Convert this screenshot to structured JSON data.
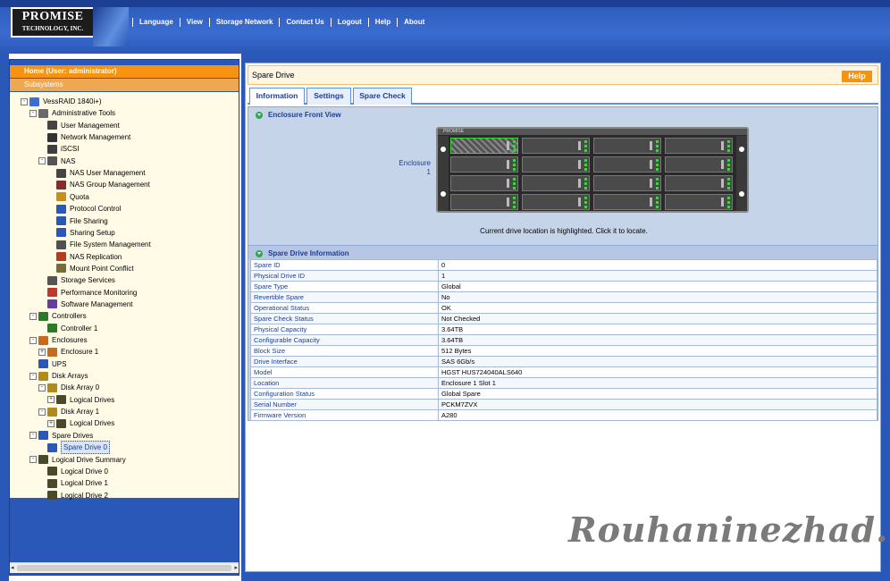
{
  "brand": {
    "line1": "PROMISE",
    "line2": "TECHNOLOGY, INC."
  },
  "nav": [
    "Language",
    "View",
    "Storage Network",
    "Contact Us",
    "Logout",
    "Help",
    "About"
  ],
  "sidebar": {
    "home": "Home (User: administrator)",
    "subsystems": "Subsystems",
    "tree": [
      {
        "label": "VessRAID 1840i+)",
        "level": 1,
        "exp": "-",
        "icon": "subsystem-icon"
      },
      {
        "label": "Administrative Tools",
        "level": 2,
        "exp": "-",
        "icon": "tools-icon"
      },
      {
        "label": "User Management",
        "level": 3,
        "icon": "user-icon"
      },
      {
        "label": "Network Management",
        "level": 3,
        "icon": "network-icon"
      },
      {
        "label": "iSCSI",
        "level": 3,
        "icon": "iscsi-icon"
      },
      {
        "label": "NAS",
        "level": 3,
        "exp": "-",
        "icon": "nas-icon"
      },
      {
        "label": "NAS User Management",
        "level": 4,
        "icon": "user-icon"
      },
      {
        "label": "NAS Group Management",
        "level": 4,
        "icon": "group-icon"
      },
      {
        "label": "Quota",
        "level": 4,
        "icon": "quota-icon"
      },
      {
        "label": "Protocol Control",
        "level": 4,
        "icon": "protocol-icon"
      },
      {
        "label": "File Sharing",
        "level": 4,
        "icon": "folder-icon"
      },
      {
        "label": "Sharing Setup",
        "level": 4,
        "icon": "folder-icon"
      },
      {
        "label": "File System Management",
        "level": 4,
        "icon": "filesystem-icon"
      },
      {
        "label": "NAS Replication",
        "level": 4,
        "icon": "replication-icon"
      },
      {
        "label": "Mount Point Conflict",
        "level": 4,
        "icon": "disk-icon"
      },
      {
        "label": "Storage Services",
        "level": 3,
        "icon": "storage-icon"
      },
      {
        "label": "Performance Monitoring",
        "level": 3,
        "icon": "chart-icon"
      },
      {
        "label": "Software Management",
        "level": 3,
        "icon": "software-icon"
      },
      {
        "label": "Controllers",
        "level": 2,
        "exp": "-",
        "icon": "controller-icon"
      },
      {
        "label": "Controller 1",
        "level": 3,
        "icon": "controller-icon"
      },
      {
        "label": "Enclosures",
        "level": 2,
        "exp": "-",
        "icon": "enclosure-icon"
      },
      {
        "label": "Enclosure 1",
        "level": 3,
        "exp": "+",
        "icon": "enclosure-icon"
      },
      {
        "label": "UPS",
        "level": 2,
        "icon": "ups-icon"
      },
      {
        "label": "Disk Arrays",
        "level": 2,
        "exp": "-",
        "icon": "array-icon"
      },
      {
        "label": "Disk Array 0",
        "level": 3,
        "exp": "-",
        "icon": "array-icon"
      },
      {
        "label": "Logical Drives",
        "level": 4,
        "exp": "+",
        "icon": "drive-icon"
      },
      {
        "label": "Disk Array 1",
        "level": 3,
        "exp": "-",
        "icon": "array-icon"
      },
      {
        "label": "Logical Drives",
        "level": 4,
        "exp": "+",
        "icon": "drive-icon"
      },
      {
        "label": "Spare Drives",
        "level": 2,
        "exp": "-",
        "icon": "spare-icon"
      },
      {
        "label": "Spare Drive 0",
        "level": 3,
        "icon": "spare-icon",
        "selected": true
      },
      {
        "label": "Logical Drive Summary",
        "level": 2,
        "exp": "-",
        "icon": "drive-icon"
      },
      {
        "label": "Logical Drive 0",
        "level": 3,
        "icon": "drive-icon"
      },
      {
        "label": "Logical Drive 1",
        "level": 3,
        "icon": "drive-icon"
      },
      {
        "label": "Logical Drive 2",
        "level": 3,
        "icon": "drive-icon"
      }
    ]
  },
  "main": {
    "title": "Spare Drive",
    "help": "Help",
    "tabs": [
      "Information",
      "Settings",
      "Spare Check"
    ],
    "front_view_header": "Enclosure Front View",
    "enclosure_label_1": "Enclosure",
    "enclosure_label_2": "1",
    "locate_msg": "Current drive location is highlighted. Click it to locate.",
    "info_header": "Spare Drive Information",
    "info": [
      [
        "Spare ID",
        "0"
      ],
      [
        "Physical Drive ID",
        "1"
      ],
      [
        "Spare Type",
        "Global"
      ],
      [
        "Revertible Spare",
        "No"
      ],
      [
        "Operational Status",
        "OK"
      ],
      [
        "Spare Check Status",
        "Not Checked"
      ],
      [
        "Physical Capacity",
        "3.64TB"
      ],
      [
        "Configurable Capacity",
        "3.64TB"
      ],
      [
        "Block Size",
        "512 Bytes"
      ],
      [
        "Drive Interface",
        "SAS 6Gb/s"
      ],
      [
        "Model",
        "HGST HUS724040ALS640"
      ],
      [
        "Location",
        "Enclosure 1 Slot 1"
      ],
      [
        "Configuration Status",
        "Global Spare"
      ],
      [
        "Serial Number",
        "PCKM7ZVX"
      ],
      [
        "Firmware Version",
        "A280"
      ]
    ]
  },
  "watermark": "Rouhaninezhad.ir",
  "colors": {
    "header_blue": "#2a58b8",
    "accent_orange": "#f69310",
    "led_green": "#3fd43f"
  }
}
